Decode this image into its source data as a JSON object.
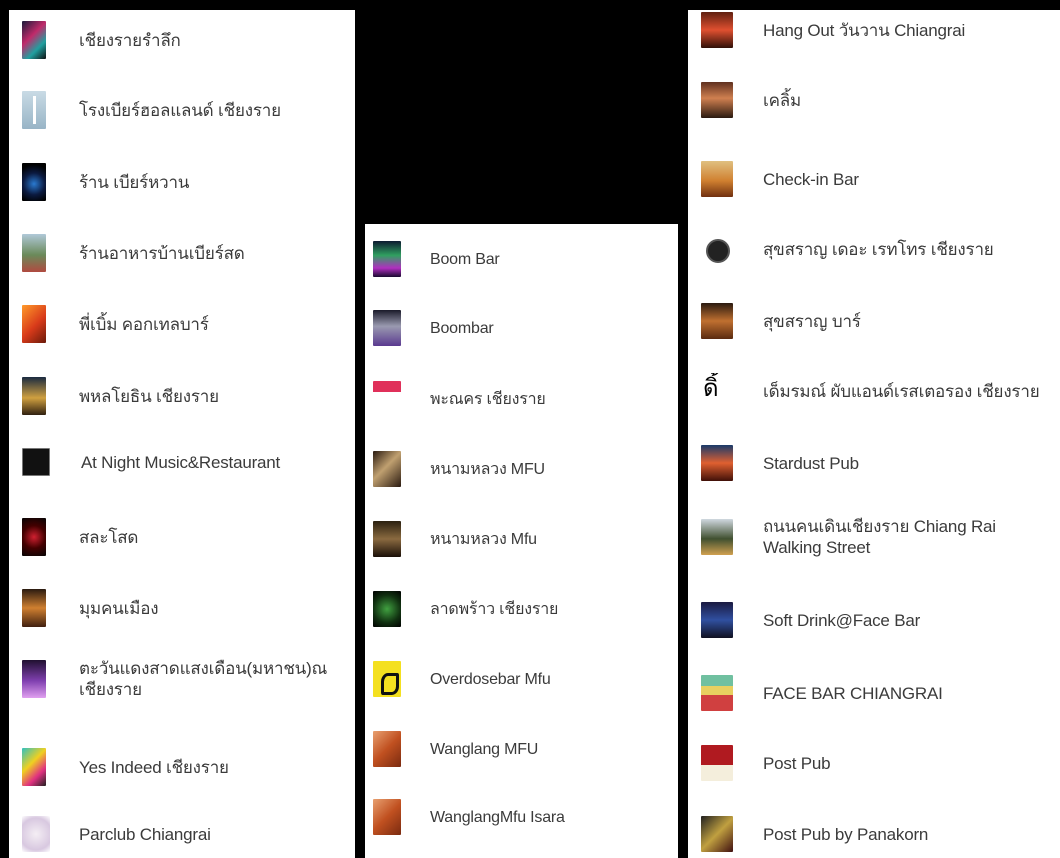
{
  "column_1": {
    "items": [
      {
        "label": "เชียงรายรำลึก",
        "icon": "neon-photo-icon"
      },
      {
        "label": "โรงเบียร์ฮอลแลนด์ เชียงราย",
        "icon": "fork-knife-icon"
      },
      {
        "label": "ร้าน เบียร์หวาน",
        "icon": "night-photo-icon"
      },
      {
        "label": "ร้านอาหารบ้านเบียร์สด",
        "icon": "street-photo-icon"
      },
      {
        "label": "พี่เบิ้ม คอกเทลบาร์",
        "icon": "orange-bar-photo-icon"
      },
      {
        "label": "พหลโยธิน เชียงราย",
        "icon": "house-photo-icon"
      },
      {
        "label": "At Night Music&Restaurant",
        "icon": "at-logo-icon"
      },
      {
        "label": "สละโสด",
        "icon": "red-light-photo-icon"
      },
      {
        "label": "มุมคนเมือง",
        "icon": "lights-photo-icon"
      },
      {
        "label": "ตะวันแดงสาดแสงเดือน(มหาชน)ณ เชียงราย",
        "icon": "purple-stage-photo-icon"
      },
      {
        "label": "Yes Indeed เชียงราย",
        "icon": "dragonfly-logo-icon"
      },
      {
        "label": "Parclub Chiangrai",
        "icon": "parclub-logo-icon"
      }
    ]
  },
  "column_2": {
    "items": [
      {
        "label": "Boom Bar",
        "icon": "boom-bar-photo-icon"
      },
      {
        "label": "Boombar",
        "icon": "boombar-photo-icon"
      },
      {
        "label": "พะณคร เชียงราย",
        "icon": "panakorn-logo-icon"
      },
      {
        "label": "หนามหลวง MFU",
        "icon": "bird-photo-icon"
      },
      {
        "label": "หนามหลวง Mfu",
        "icon": "dark-photo-icon"
      },
      {
        "label": "ลาดพร้าว เชียงราย",
        "icon": "green-logo-icon"
      },
      {
        "label": "Overdosebar Mfu",
        "icon": "overdose-logo-icon"
      },
      {
        "label": "Wanglang MFU",
        "icon": "wanglang-logo-icon"
      },
      {
        "label": "WanglangMfu Isara",
        "icon": "wanglang-logo-icon"
      }
    ]
  },
  "column_3": {
    "items": [
      {
        "label": "Hang Out วันวาน Chiangrai",
        "icon": "hangout-photo-icon"
      },
      {
        "label": "เคลิ้ม",
        "icon": "person-photo-icon"
      },
      {
        "label": "Check-in Bar",
        "icon": "beer-photo-icon"
      },
      {
        "label": "สุขสราญ เดอะ เรทโทร เชียงราย",
        "icon": "record-logo-icon"
      },
      {
        "label": "สุขสราญ บาร์",
        "icon": "sugsarn-photo-icon"
      },
      {
        "label": "เด็มรมณ์ ผับแอนด์เรสเตอรอง เชียงราย",
        "icon": "dim-logo-icon"
      },
      {
        "label": "Stardust Pub",
        "icon": "stardust-photo-icon"
      },
      {
        "label": "ถนนคนเดินเชียงราย Chiang Rai Walking Street",
        "icon": "walking-street-photo-icon"
      },
      {
        "label": "Soft Drink@Face Bar",
        "icon": "face-bar-photo-icon"
      },
      {
        "label": "FACE BAR CHIANGRAI",
        "icon": "face-bar-logo-icon"
      },
      {
        "label": "Post Pub",
        "icon": "post-pub-logo-icon"
      },
      {
        "label": "Post Pub by Panakorn",
        "icon": "post-pub-photo-icon"
      }
    ]
  }
}
